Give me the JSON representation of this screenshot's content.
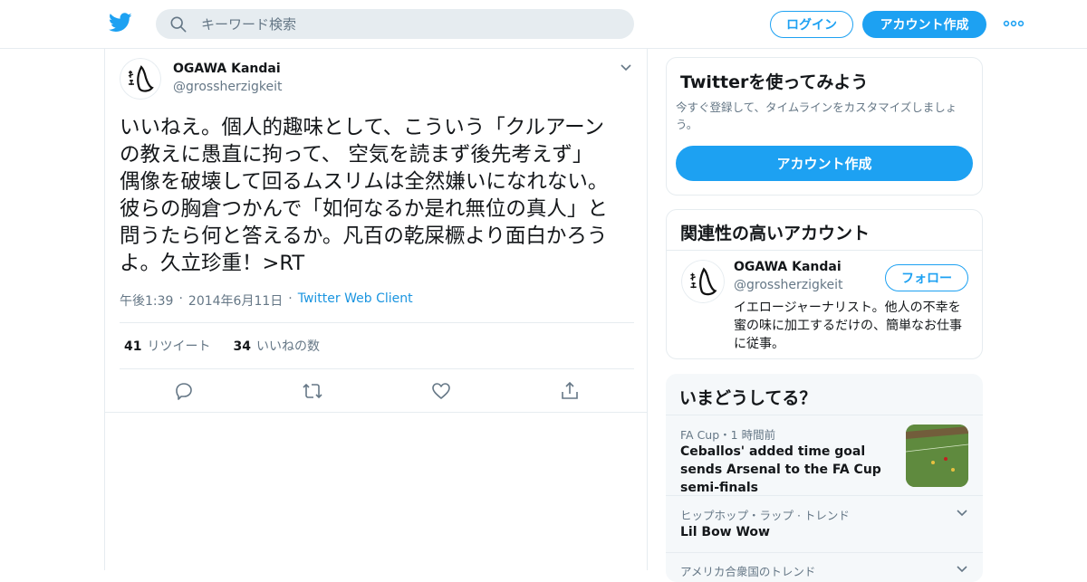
{
  "header": {
    "search_placeholder": "キーワード検索",
    "login_label": "ログイン",
    "signup_label": "アカウント作成",
    "icons": {
      "logo": "twitter-bird-icon",
      "search": "search-icon",
      "more": "more-dots-icon"
    }
  },
  "tweet": {
    "author_name": "OGAWA Kandai",
    "author_handle": "@grossherzigkeit",
    "text": "いいねえ。個人的趣味として、こういう「クルアーン\nの教えに愚直に拘って、 空気を読まず後先考えず」\n偶像を破壊して回るムスリムは全然嫌いになれない。\n彼らの胸倉つかんで「如何なるか是れ無位の真人」と\n問うたら何と答えるか。凡百の乾屎橛より面白かろう\nよ。久立珍重！>RT",
    "time": "午後1:39",
    "date": "2014年6月11日",
    "client": "Twitter Web Client",
    "separator": "·",
    "retweets_count": "41",
    "retweets_label": "リツイート",
    "likes_count": "34",
    "likes_label": "いいねの数"
  },
  "sidebar": {
    "signup_card": {
      "title": "Twitterを使ってみよう",
      "description": "今すぐ登録して、タイムラインをカスタマイズしましょう。",
      "cta_label": "アカウント作成"
    },
    "related": {
      "title": "関連性の高いアカウント",
      "account_name": "OGAWA Kandai",
      "account_handle": "@grossherzigkeit",
      "follow_label": "フォロー",
      "bio": "イエロージャーナリスト。他人の不幸を蜜の味に加工するだけの、簡単なお仕事に従事。"
    },
    "trends": {
      "title": "いまどうしてる？",
      "items": [
        {
          "meta": "FA Cup・1 時間前",
          "title": "Ceballos' added time goal sends Arsenal to the FA Cup semi-finals"
        },
        {
          "meta": "ヒップホップ・ラップ · トレンド",
          "title": "Lil Bow Wow"
        },
        {
          "meta": "アメリカ合衆国のトレンド",
          "title": ""
        }
      ]
    }
  },
  "colors": {
    "accent": "#1da1f2",
    "text": "#14171a",
    "secondary": "#657786",
    "border": "#e6ecf0",
    "link": "#1b95e0"
  }
}
